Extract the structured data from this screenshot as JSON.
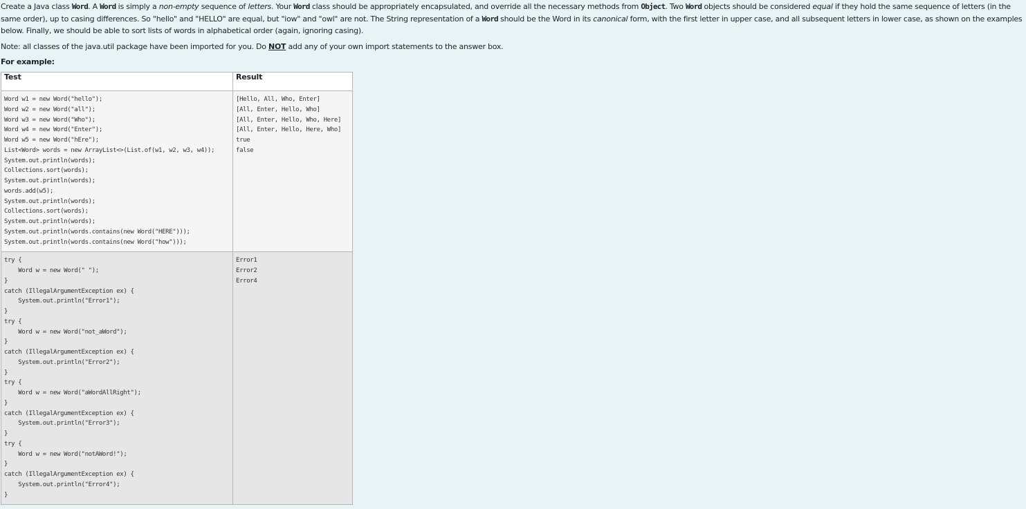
{
  "intro": {
    "parts": [
      {
        "t": "Create a Java class ",
        "k": "text"
      },
      {
        "t": "Word",
        "k": "code"
      },
      {
        "t": ". A ",
        "k": "text"
      },
      {
        "t": "Word",
        "k": "code"
      },
      {
        "t": " is simply a ",
        "k": "text"
      },
      {
        "t": "non-empty",
        "k": "em"
      },
      {
        "t": " sequence of ",
        "k": "text"
      },
      {
        "t": "letters",
        "k": "em"
      },
      {
        "t": ". Your ",
        "k": "text"
      },
      {
        "t": "Word",
        "k": "code"
      },
      {
        "t": " class should be appropriately encapsulated, and override all the necessary methods from ",
        "k": "text"
      },
      {
        "t": "Object",
        "k": "code"
      },
      {
        "t": ". Two ",
        "k": "text"
      },
      {
        "t": "Word",
        "k": "code"
      },
      {
        "t": " objects should be considered ",
        "k": "text"
      },
      {
        "t": "equal",
        "k": "em"
      },
      {
        "t": " if they hold the same sequence of letters (in the same order), up to casing differences. So \"hello\" and \"HELLO\" are equal, but \"iow\" and \"owl\" are not. The String representation of a ",
        "k": "text"
      },
      {
        "t": "Word",
        "k": "code"
      },
      {
        "t": " should be the Word in its ",
        "k": "text"
      },
      {
        "t": "canonical",
        "k": "em"
      },
      {
        "t": " form, with the first letter in upper case, and all subsequent letters in lower case, as shown on the examples below. Finally, we should be able to sort lists of words in alphabetical order (again, ignoring casing).",
        "k": "text"
      }
    ]
  },
  "note": {
    "before": "Note: all classes of the java.util package have been imported for you. Do ",
    "strong": "NOT",
    "after": " add any of your own import statements to the answer box."
  },
  "for_example": "For example:",
  "table": {
    "headers": {
      "test": "Test",
      "result": "Result"
    },
    "rows": [
      {
        "test": "Word w1 = new Word(\"hello\");\nWord w2 = new Word(\"all\");\nWord w3 = new Word(\"Who\");\nWord w4 = new Word(\"Enter\");\nWord w5 = new Word(\"hEre\");\nList<Word> words = new ArrayList<>(List.of(w1, w2, w3, w4));\nSystem.out.println(words);\nCollections.sort(words);\nSystem.out.println(words);\nwords.add(w5);\nSystem.out.println(words);\nCollections.sort(words);\nSystem.out.println(words);\nSystem.out.println(words.contains(new Word(\"HERE\")));\nSystem.out.println(words.contains(new Word(\"how\")));",
        "result": "[Hello, All, Who, Enter]\n[All, Enter, Hello, Who]\n[All, Enter, Hello, Who, Here]\n[All, Enter, Hello, Here, Who]\ntrue\nfalse"
      },
      {
        "test": "try {\n    Word w = new Word(\" \");\n}\ncatch (IllegalArgumentException ex) {\n    System.out.println(\"Error1\");\n}\ntry {\n    Word w = new Word(\"not_aWord\");\n}\ncatch (IllegalArgumentException ex) {\n    System.out.println(\"Error2\");\n}\ntry {\n    Word w = new Word(\"aWordAllRight\");\n}\ncatch (IllegalArgumentException ex) {\n    System.out.println(\"Error3\");\n}\ntry {\n    Word w = new Word(\"notAWord!\");\n}\ncatch (IllegalArgumentException ex) {\n    System.out.println(\"Error4\");\n}",
        "result": "Error1\nError2\nError4"
      }
    ]
  }
}
